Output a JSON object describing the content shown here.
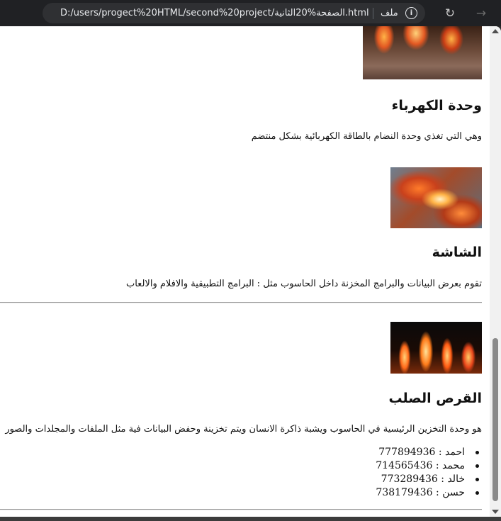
{
  "browser": {
    "url": "D:/users/progect%20HTML/second%20project/الصفحة%20الثانية.html",
    "file_label": "ملف",
    "info_icon": "info-icon",
    "reload_icon": "reload-icon",
    "forward_icon": "forward-icon"
  },
  "sections": [
    {
      "heading": "وحدة الكهرباء",
      "text": "وهي التي تغذي وحدة النضام بالطاقة الكهربائية بشكل منتضم"
    },
    {
      "heading": "الشاشة",
      "text": "تقوم بعرض البيانات والبرامج المخزنة داخل الحاسوب مثل : البرامج التطبيقية والافلام والالعاب"
    },
    {
      "heading": "القرص الصلب",
      "text": "هو وحدة التخزين الرئيسية في الحاسوب ويشبة ذاكرة الانسان ويتم تخزينة وحفض البيانات فية مثل الملفات والمجلدات والصور"
    }
  ],
  "contacts": [
    "احمد : 777894936",
    "محمد : 714565436",
    "خالد : 773289436",
    "حسن : 738179436"
  ]
}
